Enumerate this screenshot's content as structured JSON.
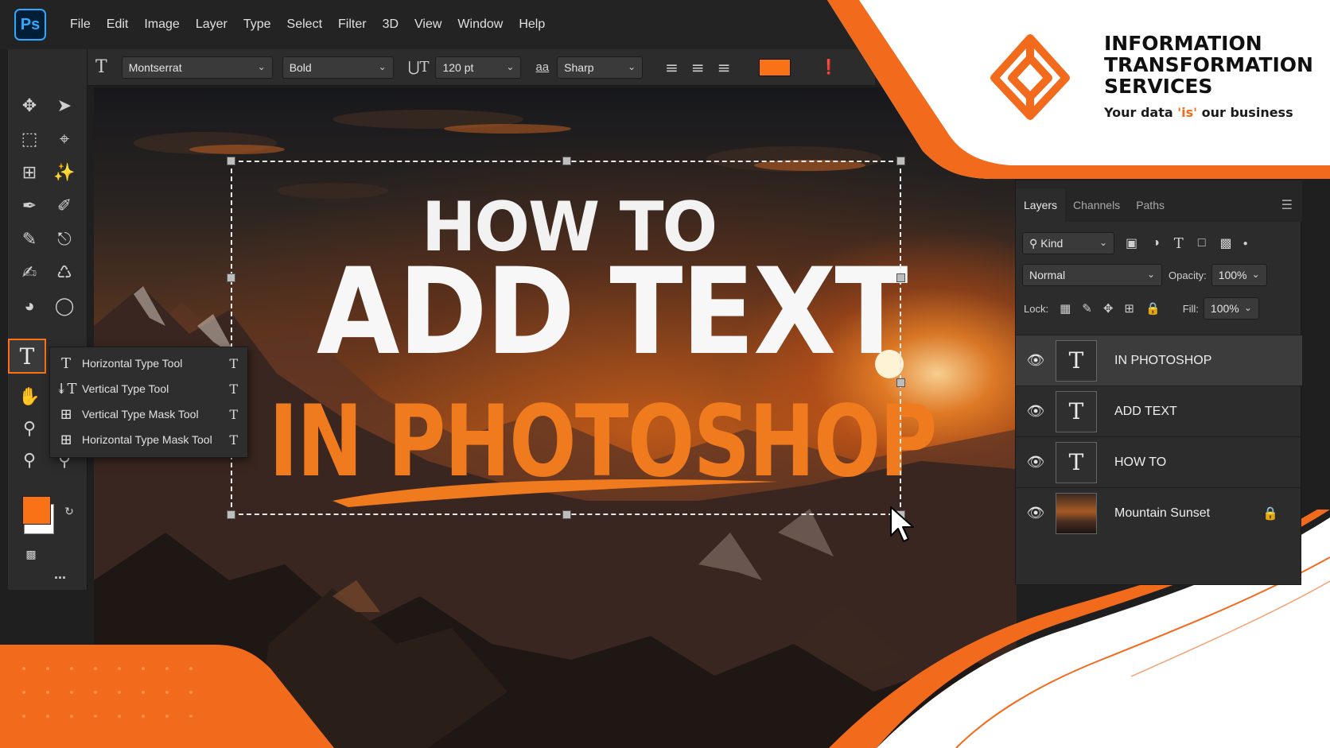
{
  "app": {
    "logo": "Ps",
    "menu": [
      "File",
      "Edit",
      "Image",
      "Layer",
      "Type",
      "Select",
      "Filter",
      "3D",
      "View",
      "Window",
      "Help"
    ]
  },
  "options_bar": {
    "font_family": "Montserrat",
    "font_style": "Bold",
    "font_size": "120 pt",
    "aa_label": "aa",
    "antialias": "Sharp",
    "text_color": "#f97316"
  },
  "toolbar": {
    "foreground_color": "#f97316",
    "background_color": "#ffffff",
    "more_label": "..."
  },
  "flyout": {
    "items": [
      {
        "label": "Horizontal Type Tool",
        "shortcut": "T"
      },
      {
        "label": "Vertical Type Tool",
        "shortcut": "T"
      },
      {
        "label": "Vertical Type Mask Tool",
        "shortcut": "T"
      },
      {
        "label": "Horizontal Type Mask Tool",
        "shortcut": "T"
      }
    ]
  },
  "canvas": {
    "line1": "HOW TO",
    "line2": "ADD TEXT",
    "line3": "IN PHOTOSHOP",
    "accent_color": "#f07a1e"
  },
  "layers_panel": {
    "tabs": [
      "Layers",
      "Channels",
      "Paths"
    ],
    "filter_kind": "Kind",
    "blend_mode": "Normal",
    "opacity_label": "Opacity:",
    "opacity": "100%",
    "lock_label": "Lock:",
    "fill_label": "Fill:",
    "fill": "100%",
    "layers": [
      {
        "name": "IN PHOTOSHOP",
        "type": "text"
      },
      {
        "name": "ADD TEXT",
        "type": "text"
      },
      {
        "name": "HOW TO",
        "type": "text"
      },
      {
        "name": "Mountain Sunset",
        "type": "image"
      }
    ]
  },
  "brand": {
    "line1": "INFORMATION",
    "line2": "TRANSFORMATION",
    "line3": "SERVICES",
    "tagline_pre": "Your data ",
    "tagline_is": "'is'",
    "tagline_post": " our business",
    "accent": "#f26b1d"
  }
}
